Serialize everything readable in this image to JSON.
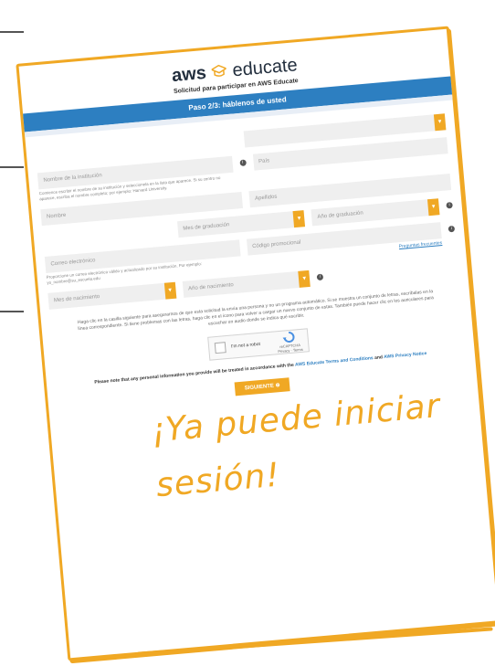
{
  "header": {
    "logo_aws": "aws",
    "logo_educate": "educate",
    "subtitle": "Solicitud para participar en AWS Educate",
    "step": "Paso 2/3: háblenos de usted"
  },
  "form": {
    "institution_label": "Nombre de la institución",
    "institution_help": "Comience escribir el nombre de su institución y seleccionela en la lista que aparece. Si su centro no aparece, escriba el nombre completo; por ejemplo: Harvard University.",
    "country_label": "País",
    "first_name": "Nombre",
    "last_name": "Apellidos",
    "email_label": "Correo electrónico",
    "email_help": "Proporcione un correo electrónico válido y actualizado por su institución. Por ejemplo: yo_nombre@su_escuela.edu",
    "grad_month": "Mes de graduación",
    "grad_year": "Año de graduación",
    "birth_month": "Mes de nacimiento",
    "birth_year": "Año de nacimiento",
    "promo_code": "Código promocional",
    "faq_link": "Preguntas frecuentes"
  },
  "captcha": {
    "instructions": "Haga clic en la casilla siguiente para asegurarnos de que esta solicitud la envía una persona y no un programa automático. Si se muestra un conjunto de letras, escríbalas en la línea correspondiente. Si tiene problemas con las letras, haga clic en el icono para volver a cargar un nuevo conjunto de estas. También puede hacer clic en los auriculares para escuchar un audio donde se indica qué escribir.",
    "checkbox_label": "I'm not a robot",
    "badge": "reCAPTCHA",
    "badge_sub": "Privacy · Terms"
  },
  "notice": {
    "prefix": "Please note that any personal information you provide will be treated in accordance with the",
    "terms_link": "AWS Educate Terms and Conditions",
    "and": "and",
    "privacy_link": "AWS Privacy Notice"
  },
  "next_button": "SIGUIENTE",
  "handwritten": {
    "line1": "¡Ya puede iniciar",
    "line2": "sesión!"
  },
  "colors": {
    "accent": "#f0a824",
    "bar": "#2d7fc1"
  }
}
